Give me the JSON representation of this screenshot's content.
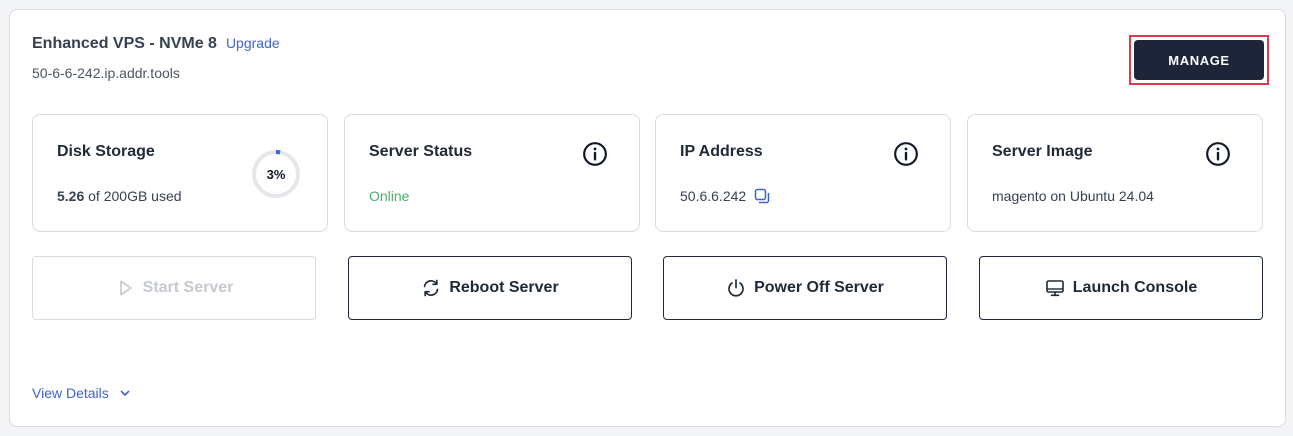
{
  "header": {
    "title": "Enhanced VPS - NVMe 8",
    "upgrade_label": "Upgrade",
    "hostname": "50-6-6-242.ip.addr.tools",
    "manage_label": "MANAGE"
  },
  "cards": {
    "disk": {
      "title": "Disk Storage",
      "used": "5.26",
      "used_suffix": "of 200GB used",
      "percent_label": "3%",
      "percent_value": 3
    },
    "status": {
      "title": "Server Status",
      "value": "Online"
    },
    "ip": {
      "title": "IP Address",
      "value": "50.6.6.242"
    },
    "image": {
      "title": "Server Image",
      "value": "magento on Ubuntu 24.04"
    }
  },
  "actions": {
    "start": "Start Server",
    "reboot": "Reboot Server",
    "power_off": "Power Off Server",
    "console": "Launch Console"
  },
  "footer": {
    "view_details": "View Details"
  },
  "colors": {
    "accent": "#3f63d3",
    "online": "#4caf6b",
    "manage_bg": "#1e2538",
    "highlight": "#e0394a"
  },
  "icons": {
    "info": "info-icon",
    "copy": "copy-icon",
    "play": "play-icon",
    "refresh": "refresh-icon",
    "power": "power-icon",
    "monitor": "monitor-icon",
    "chevron": "chevron-down-icon"
  }
}
